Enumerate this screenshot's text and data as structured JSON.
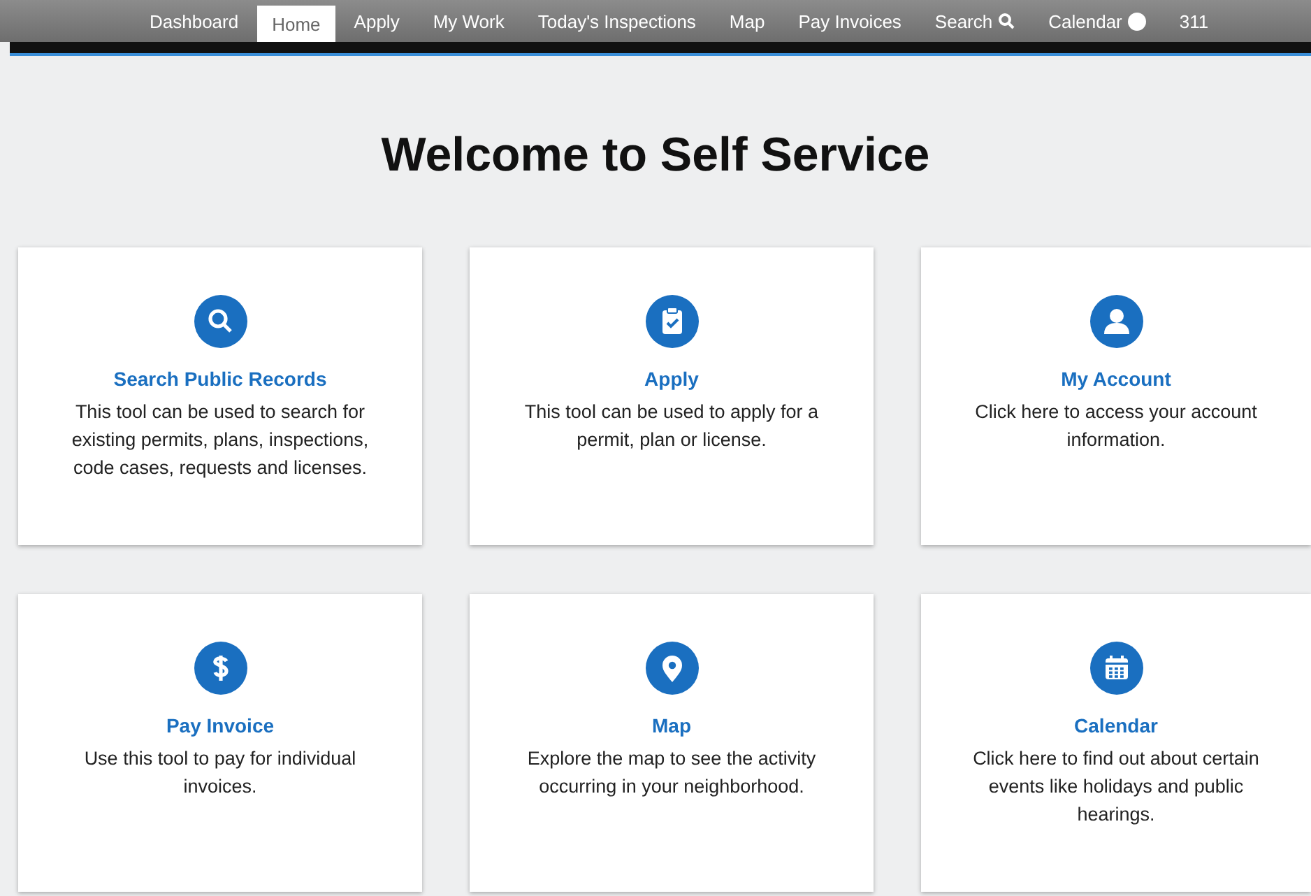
{
  "nav": [
    {
      "label": "Dashboard",
      "selected": false,
      "kind": "text"
    },
    {
      "label": "Home",
      "selected": true,
      "kind": "text"
    },
    {
      "label": "Apply",
      "selected": false,
      "kind": "text"
    },
    {
      "label": "My Work",
      "selected": false,
      "kind": "text"
    },
    {
      "label": "Today's Inspections",
      "selected": false,
      "kind": "text"
    },
    {
      "label": "Map",
      "selected": false,
      "kind": "text"
    },
    {
      "label": "Pay Invoices",
      "selected": false,
      "kind": "text"
    },
    {
      "label": "Search",
      "selected": false,
      "kind": "search"
    },
    {
      "label": "Calendar",
      "selected": false,
      "kind": "calendar"
    },
    {
      "label": "311",
      "selected": false,
      "kind": "text"
    }
  ],
  "heading": "Welcome to Self Service",
  "cards": [
    {
      "title": "Search Public Records",
      "description": "This tool can be used to search for existing permits, plans, inspections, code cases, requests and licenses."
    },
    {
      "title": "Apply",
      "description": "This tool can be used to apply for a permit, plan or license."
    },
    {
      "title": "My Account",
      "description": "Click here to access your account information."
    },
    {
      "title": "Pay Invoice",
      "description": "Use this tool to pay for individual invoices."
    },
    {
      "title": "Map",
      "description": "Explore the map to see the activity occurring in your neighborhood."
    },
    {
      "title": "Calendar",
      "description": "Click here to find out about certain events like holidays and public hearings."
    }
  ]
}
